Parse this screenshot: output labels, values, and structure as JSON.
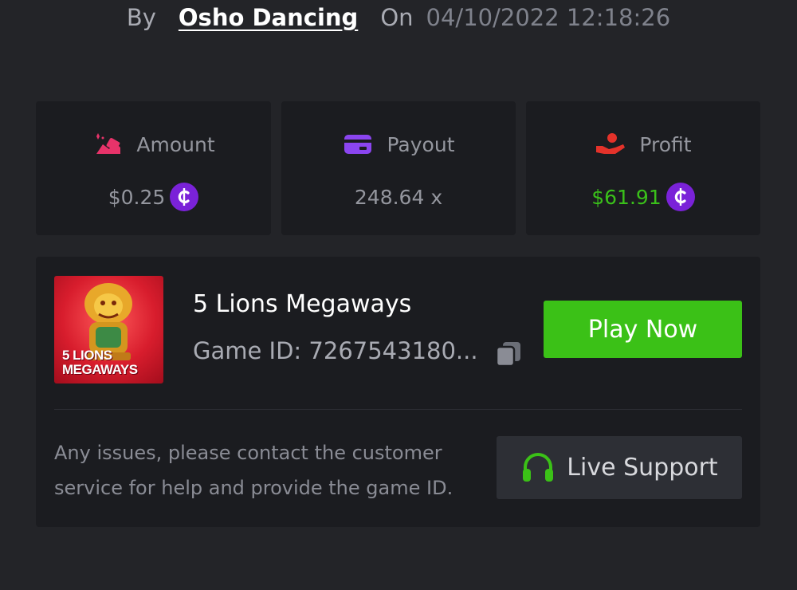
{
  "byline": {
    "by": "By",
    "username": "Osho Dancing",
    "on": "On",
    "datetime": "04/10/2022 12:18:26"
  },
  "stats": {
    "amount": {
      "label": "Amount",
      "value": "$0.25",
      "icon": "amount-icon",
      "coin": "C"
    },
    "payout": {
      "label": "Payout",
      "value": "248.64 x",
      "icon": "card-icon"
    },
    "profit": {
      "label": "Profit",
      "value": "$61.91",
      "icon": "hand-coin-icon",
      "coin": "C"
    }
  },
  "game": {
    "thumbnail_text_line1": "5 LIONS",
    "thumbnail_text_line2": "MEGAWAYS",
    "title": "5 Lions Megaways",
    "id_label": "Game ID: 7267543180...",
    "play_label": "Play Now"
  },
  "support": {
    "text": "Any issues, please contact the customer service for help and provide the game ID.",
    "button_label": "Live Support"
  },
  "colors": {
    "background": "#232428",
    "panel": "#1b1c20",
    "play_green": "#3bc117",
    "profit_green": "#3ac01a",
    "coin_purple": "#7a22d8",
    "amount_pink": "#e8336a",
    "payout_purple": "#8b45f0",
    "profit_red": "#e4322a"
  }
}
